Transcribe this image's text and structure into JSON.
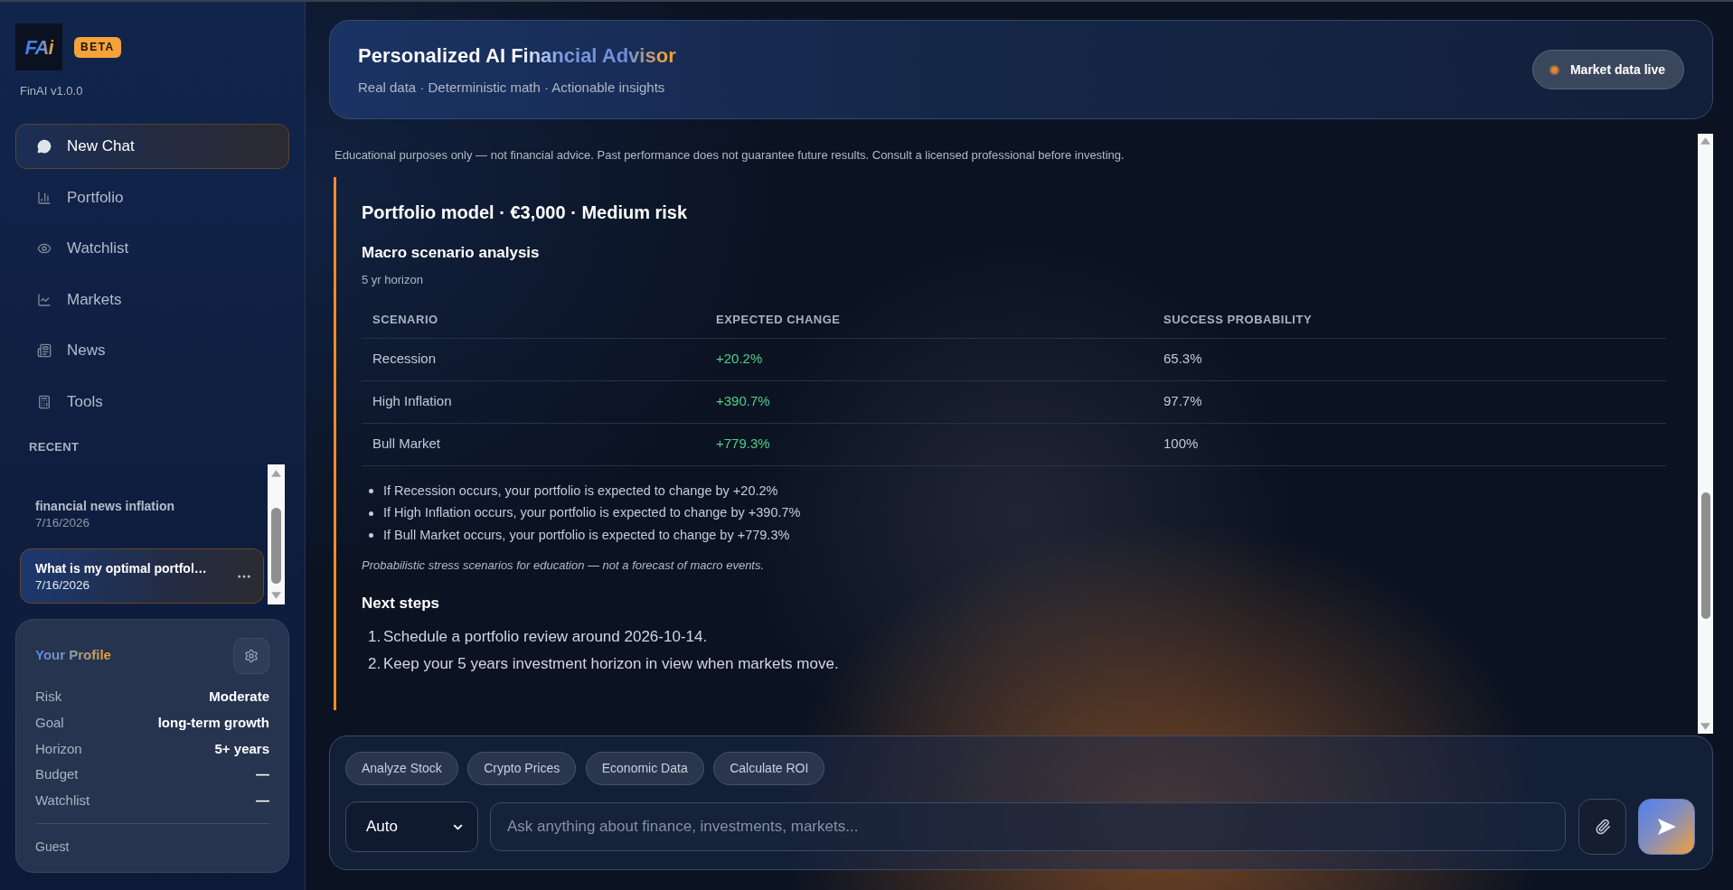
{
  "sidebar": {
    "logo": "FAi",
    "badge": "BETA",
    "version": "FinAI v1.0.0",
    "nav": [
      {
        "label": "New Chat",
        "selected": true
      },
      {
        "label": "Portfolio",
        "selected": false
      },
      {
        "label": "Watchlist",
        "selected": false
      },
      {
        "label": "Markets",
        "selected": false
      },
      {
        "label": "News",
        "selected": false
      },
      {
        "label": "Tools",
        "selected": false
      }
    ],
    "recent_heading": "RECENT",
    "recent": [
      {
        "title": "financial news inflation",
        "date": "7/16/2026",
        "selected": false
      },
      {
        "title": "What is my optimal portfol…",
        "date": "7/16/2026",
        "selected": true
      }
    ],
    "profile": {
      "title": "Your Profile",
      "rows": [
        {
          "label": "Risk",
          "value": "Moderate"
        },
        {
          "label": "Goal",
          "value": "long-term growth"
        },
        {
          "label": "Horizon",
          "value": "5+ years"
        },
        {
          "label": "Budget",
          "value": "—"
        },
        {
          "label": "Watchlist",
          "value": "—"
        }
      ],
      "user": "Guest"
    }
  },
  "header": {
    "title": "Personalized AI Financial Advisor",
    "subtitle": "Real data · Deterministic math · Actionable insights",
    "status": {
      "label": "Market data live",
      "live": true
    }
  },
  "chat": {
    "disclaimer": "Educational purposes only — not financial advice. Past performance does not guarantee future results. Consult a licensed professional before investing.",
    "message": {
      "title": "Portfolio model · €3,000 · Medium risk",
      "scenario_analysis": {
        "heading": "Macro scenario analysis",
        "subheading": "5 yr horizon",
        "table": {
          "columns": [
            "SCENARIO",
            "EXPECTED CHANGE",
            "SUCCESS PROBABILITY"
          ],
          "rows": [
            [
              "Recession",
              "+20.2%",
              "65.3%"
            ],
            [
              "High Inflation",
              "+390.7%",
              "97.7%"
            ],
            [
              "Bull Market",
              "+779.3%",
              "100%"
            ]
          ]
        },
        "bullets": [
          "If Recession occurs, your portfolio is expected to change by +20.2%",
          "If High Inflation occurs, your portfolio is expected to change by +390.7%",
          "If Bull Market occurs, your portfolio is expected to change by +779.3%"
        ],
        "note": "Probabilistic stress scenarios for education — not a forecast of macro events."
      },
      "next_steps": {
        "heading": "Next steps",
        "items": [
          {
            "number": "1.",
            "text": "Schedule a portfolio review around 2026-10-14."
          },
          {
            "number": "2.",
            "text": "Keep your 5 years investment horizon in view when markets move."
          }
        ]
      }
    }
  },
  "composer": {
    "quick_actions": [
      "Analyze Stock",
      "Crypto Prices",
      "Economic Data",
      "Calculate ROI"
    ],
    "mode": "Auto",
    "placeholder": "Ask anything about finance, investments, markets..."
  }
}
